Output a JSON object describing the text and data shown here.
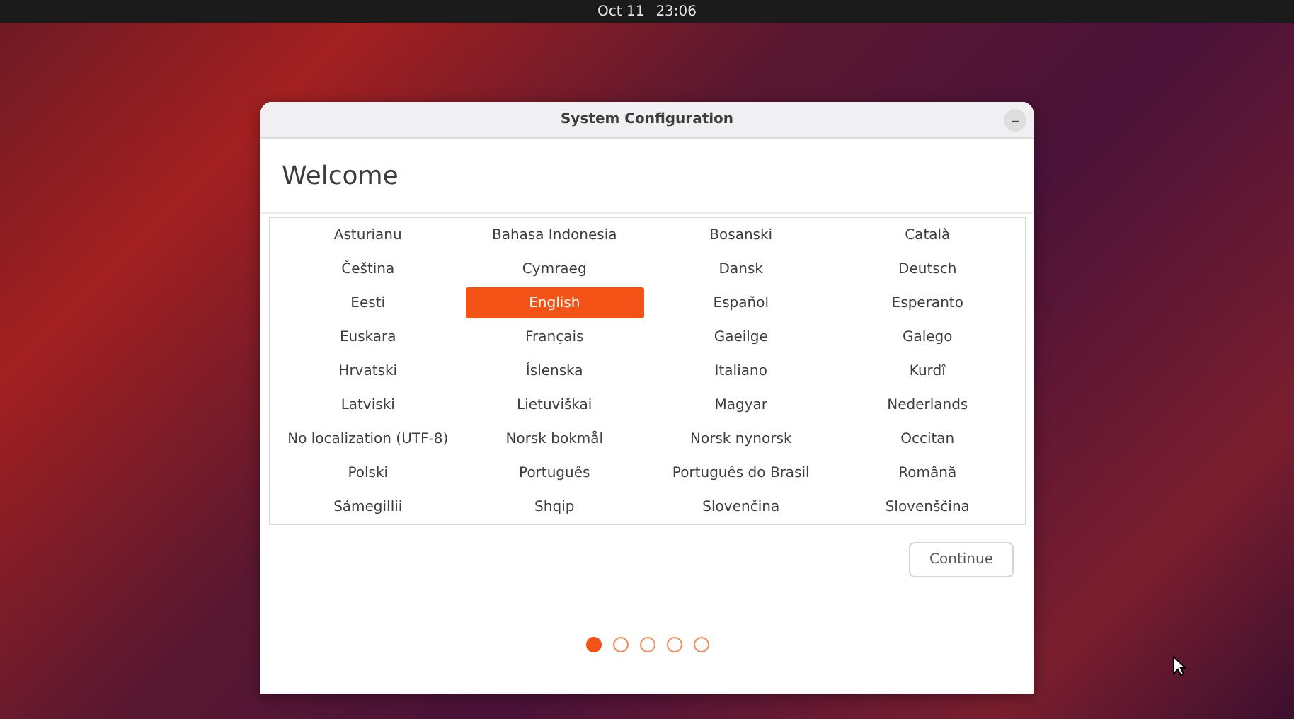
{
  "top_bar": {
    "date": "Oct 11",
    "time": "23:06"
  },
  "window": {
    "title": "System Configuration",
    "minimize": "–"
  },
  "heading": "Welcome",
  "languages": [
    {
      "label": "Asturianu",
      "selected": false
    },
    {
      "label": "Bahasa Indonesia",
      "selected": false
    },
    {
      "label": "Bosanski",
      "selected": false
    },
    {
      "label": "Català",
      "selected": false
    },
    {
      "label": "Čeština",
      "selected": false
    },
    {
      "label": "Cymraeg",
      "selected": false
    },
    {
      "label": "Dansk",
      "selected": false
    },
    {
      "label": "Deutsch",
      "selected": false
    },
    {
      "label": "Eesti",
      "selected": false
    },
    {
      "label": "English",
      "selected": true
    },
    {
      "label": "Español",
      "selected": false
    },
    {
      "label": "Esperanto",
      "selected": false
    },
    {
      "label": "Euskara",
      "selected": false
    },
    {
      "label": "Français",
      "selected": false
    },
    {
      "label": "Gaeilge",
      "selected": false
    },
    {
      "label": "Galego",
      "selected": false
    },
    {
      "label": "Hrvatski",
      "selected": false
    },
    {
      "label": "Íslenska",
      "selected": false
    },
    {
      "label": "Italiano",
      "selected": false
    },
    {
      "label": "Kurdî",
      "selected": false
    },
    {
      "label": "Latviski",
      "selected": false
    },
    {
      "label": "Lietuviškai",
      "selected": false
    },
    {
      "label": "Magyar",
      "selected": false
    },
    {
      "label": "Nederlands",
      "selected": false
    },
    {
      "label": "No localization (UTF-8)",
      "selected": false
    },
    {
      "label": "Norsk bokmål",
      "selected": false
    },
    {
      "label": "Norsk nynorsk",
      "selected": false
    },
    {
      "label": "Occitan",
      "selected": false
    },
    {
      "label": "Polski",
      "selected": false
    },
    {
      "label": "Português",
      "selected": false
    },
    {
      "label": "Português do Brasil",
      "selected": false
    },
    {
      "label": "Română",
      "selected": false
    },
    {
      "label": "Sámegillii",
      "selected": false
    },
    {
      "label": "Shqip",
      "selected": false
    },
    {
      "label": "Slovenčina",
      "selected": false
    },
    {
      "label": "Slovenščina",
      "selected": false
    }
  ],
  "continue_button": "Continue",
  "pages": [
    {
      "selected": true
    },
    {
      "selected": false
    },
    {
      "selected": false
    },
    {
      "selected": false
    },
    {
      "selected": false
    }
  ]
}
